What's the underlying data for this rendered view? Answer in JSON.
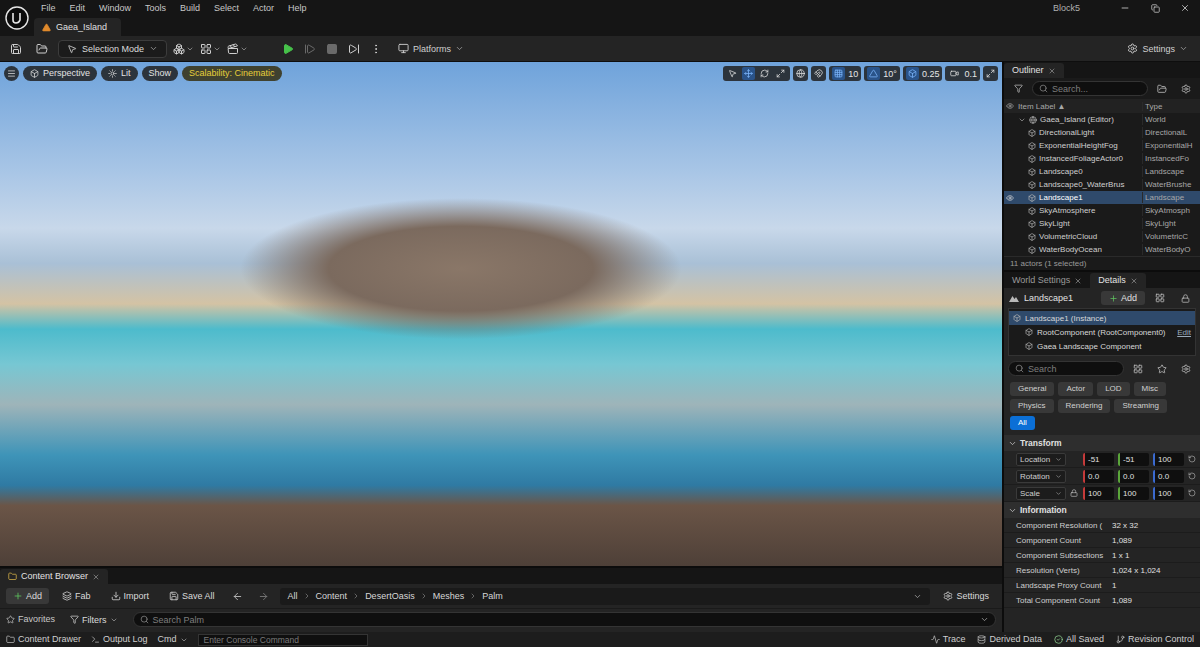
{
  "menu_bar": {
    "items": [
      "File",
      "Edit",
      "Window",
      "Tools",
      "Build",
      "Select",
      "Actor",
      "Help"
    ],
    "project": "Block5"
  },
  "tabs": [
    {
      "label": "Gaea_Island",
      "selected": true
    }
  ],
  "toolbar": {
    "mode": "Selection Mode",
    "play": [
      {
        "kind": "play",
        "disabled": false
      },
      {
        "kind": "advance",
        "disabled": true
      },
      {
        "kind": "stop",
        "disabled": true
      },
      {
        "kind": "eject",
        "disabled": false
      }
    ],
    "platforms": "Platforms",
    "settings": "Settings"
  },
  "viewport": {
    "view": "Perspective",
    "lighting": "Lit",
    "show": "Show",
    "scalability": "Scalability: Cinematic",
    "tools": [
      {
        "kind": "select",
        "selected": false
      },
      {
        "kind": "move",
        "selected": true
      },
      {
        "kind": "rotate",
        "selected": false
      },
      {
        "kind": "scale",
        "selected": false
      }
    ],
    "snaps": [
      {
        "kind": "grid",
        "value": "10",
        "on": true
      },
      {
        "kind": "rotation",
        "value": "10°",
        "on": true
      },
      {
        "kind": "scale",
        "value": "0.25",
        "on": true
      },
      {
        "kind": "camera",
        "value": "0.1",
        "on": false
      }
    ]
  },
  "outliner": {
    "title": "Outliner",
    "search": {
      "placeholder": "Search..."
    },
    "columns": [
      "Item Label ▲",
      "Type"
    ],
    "rows": [
      {
        "label": "Gaea_Island (Editor)",
        "type": "World",
        "kind": "world",
        "depth": 0,
        "expanded": true,
        "selected": false,
        "visible": false
      },
      {
        "label": "DirectionalLight",
        "type": "DirectionalL",
        "kind": "actor",
        "depth": 1,
        "expanded": false,
        "selected": false,
        "visible": false
      },
      {
        "label": "ExponentialHeightFog",
        "type": "ExponentialH",
        "kind": "actor",
        "depth": 1,
        "expanded": false,
        "selected": false,
        "visible": false
      },
      {
        "label": "InstancedFoliageActor0",
        "type": "InstancedFo",
        "kind": "actor",
        "depth": 1,
        "expanded": false,
        "selected": false,
        "visible": false
      },
      {
        "label": "Landscape0",
        "type": "Landscape",
        "kind": "actor",
        "depth": 1,
        "expanded": false,
        "selected": false,
        "visible": false
      },
      {
        "label": "Landscape0_WaterBrus",
        "type": "WaterBrushe",
        "kind": "actor",
        "depth": 1,
        "expanded": false,
        "selected": false,
        "visible": false
      },
      {
        "label": "Landscape1",
        "type": "Landscape",
        "kind": "actor",
        "depth": 1,
        "expanded": false,
        "selected": true,
        "visible": true
      },
      {
        "label": "SkyAtmosphere",
        "type": "SkyAtmosph",
        "kind": "actor",
        "depth": 1,
        "expanded": false,
        "selected": false,
        "visible": false
      },
      {
        "label": "SkyLight",
        "type": "SkyLight",
        "kind": "actor",
        "depth": 1,
        "expanded": false,
        "selected": false,
        "visible": false
      },
      {
        "label": "VolumetricCloud",
        "type": "VolumetricC",
        "kind": "actor",
        "depth": 1,
        "expanded": false,
        "selected": false,
        "visible": false
      },
      {
        "label": "WaterBodyOcean",
        "type": "WaterBodyO",
        "kind": "actor",
        "depth": 1,
        "expanded": false,
        "selected": false,
        "visible": false
      }
    ],
    "footer": "11 actors (1 selected)"
  },
  "details": {
    "tabs": [
      {
        "label": "World Settings",
        "selected": false
      },
      {
        "label": "Details",
        "selected": true
      }
    ],
    "actor": "Landscape1",
    "add": "Add",
    "components": [
      {
        "label": "Landscape1 (Instance)",
        "depth": 0,
        "selected": true
      },
      {
        "label": "RootComponent (RootComponent0)",
        "depth": 1,
        "selected": false,
        "action": "Edit"
      },
      {
        "label": "Gaea Landscape Component",
        "depth": 1,
        "selected": false
      }
    ],
    "search": {
      "placeholder": "Search"
    },
    "filters": [
      {
        "label": "General",
        "selected": false
      },
      {
        "label": "Actor",
        "selected": false
      },
      {
        "label": "LOD",
        "selected": false
      },
      {
        "label": "Misc",
        "selected": false
      },
      {
        "label": "Physics",
        "selected": false
      },
      {
        "label": "Rendering",
        "selected": false
      },
      {
        "label": "Streaming",
        "selected": false
      },
      {
        "label": "All",
        "selected": true
      }
    ],
    "sections": [
      {
        "title": "Transform",
        "kind": "transform",
        "expanded": true,
        "rows": [
          {
            "label": "Location",
            "values": [
              "-51",
              "-51",
              "100"
            ],
            "lockable": false
          },
          {
            "label": "Rotation",
            "values": [
              "0.0",
              "0.0",
              "0.0"
            ],
            "lockable": false
          },
          {
            "label": "Scale",
            "values": [
              "100",
              "100",
              "100"
            ],
            "lockable": true
          }
        ]
      },
      {
        "title": "Information",
        "kind": "info",
        "expanded": true,
        "rows": [
          {
            "label": "Component Resolution (",
            "value": "32 x 32"
          },
          {
            "label": "Component Count",
            "value": "1,089"
          },
          {
            "label": "Component Subsections",
            "value": "1 x 1"
          },
          {
            "label": "Resolution (Verts)",
            "value": "1,024 x 1,024"
          },
          {
            "label": "Landscape Proxy Count",
            "value": "1"
          },
          {
            "label": "Total Component Count",
            "value": "1,089"
          }
        ]
      }
    ]
  },
  "content_browser": {
    "title": "Content Browser",
    "actions": [
      {
        "label": "Add",
        "kind": "add"
      },
      {
        "label": "Fab",
        "kind": "fab"
      },
      {
        "label": "Import",
        "kind": "import"
      },
      {
        "label": "Save All",
        "kind": "save"
      }
    ],
    "path": [
      "All",
      "Content",
      "DesertOasis",
      "Meshes",
      "Palm"
    ],
    "settings": "Settings",
    "sidebar": "Favorites",
    "filters": "Filters",
    "search": {
      "placeholder": "Search Palm"
    }
  },
  "status_bar": {
    "left": [
      {
        "label": "Content Drawer",
        "kind": "drawer"
      },
      {
        "label": "Output Log",
        "kind": "log"
      },
      {
        "label": "Cmd",
        "kind": "cmd"
      }
    ],
    "console": {
      "placeholder": "Enter Console Command"
    },
    "right": [
      {
        "label": "Trace",
        "kind": "trace"
      },
      {
        "label": "Derived Data",
        "kind": "data"
      },
      {
        "label": "All Saved",
        "kind": "saved"
      },
      {
        "label": "Revision Control",
        "kind": "revision"
      }
    ]
  }
}
